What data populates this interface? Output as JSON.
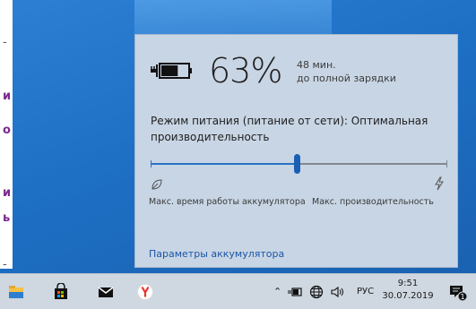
{
  "battery": {
    "percent_text": "63%",
    "level": 0.63,
    "time_line1": "48 мин.",
    "time_line2": "до полной зарядки"
  },
  "power_mode": {
    "label": "Режим питания (питание от сети): Оптимальная производительность",
    "slider_value": 0.5,
    "left_label": "Макс. время работы аккумулятора",
    "right_label": "Макс. производительность"
  },
  "settings_link": "Параметры аккумулятора",
  "taskbar": {
    "icons": [
      "file-explorer-icon",
      "store-icon",
      "mail-icon",
      "yandex-browser-icon"
    ],
    "tray": {
      "language": "РУС",
      "time": "9:51",
      "date": "30.07.2019",
      "notification_count": "1"
    }
  },
  "colors": {
    "desktop": "#1d6fc4",
    "flyout_bg": "#c8d5e4",
    "accent": "#1a5fb4",
    "link": "#1a56a8"
  }
}
